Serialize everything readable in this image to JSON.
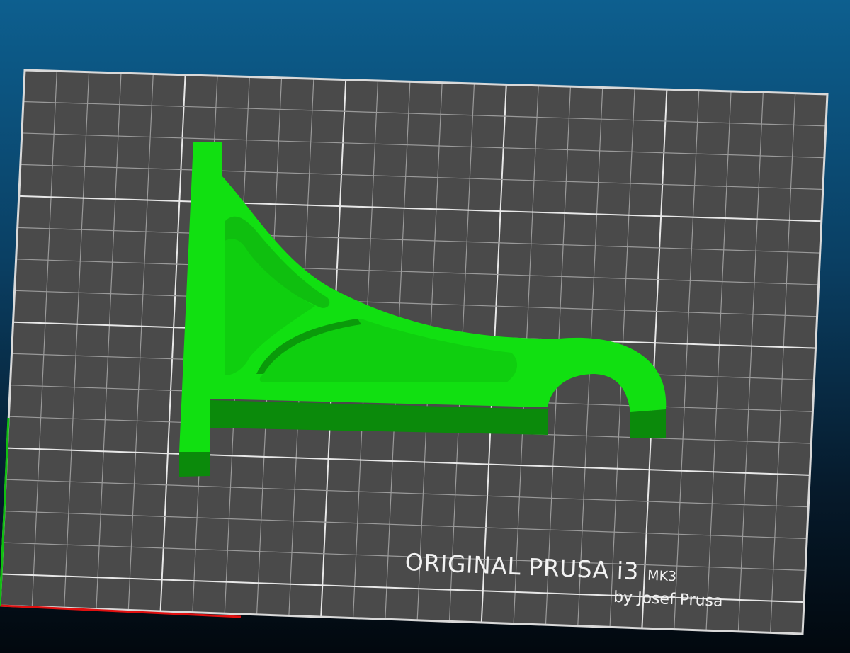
{
  "bed_label": {
    "brand": "ORIGINAL PRUSA i3",
    "model_suffix": "MK3",
    "author": "by Josef Prusa"
  },
  "colors": {
    "background_top": "#0d5f8f",
    "background_bottom": "#02080e",
    "bed_surface": "#4a4a4a",
    "grid_minor": "#9a9a9a",
    "grid_major": "#e8e8e8",
    "model_top": "#11e011",
    "model_side": "#0b8a0b",
    "axis_x": "#e01010",
    "axis_y": "#10c010"
  },
  "scene": {
    "model_name_icon": "bracket-part",
    "axes_visible": true
  }
}
